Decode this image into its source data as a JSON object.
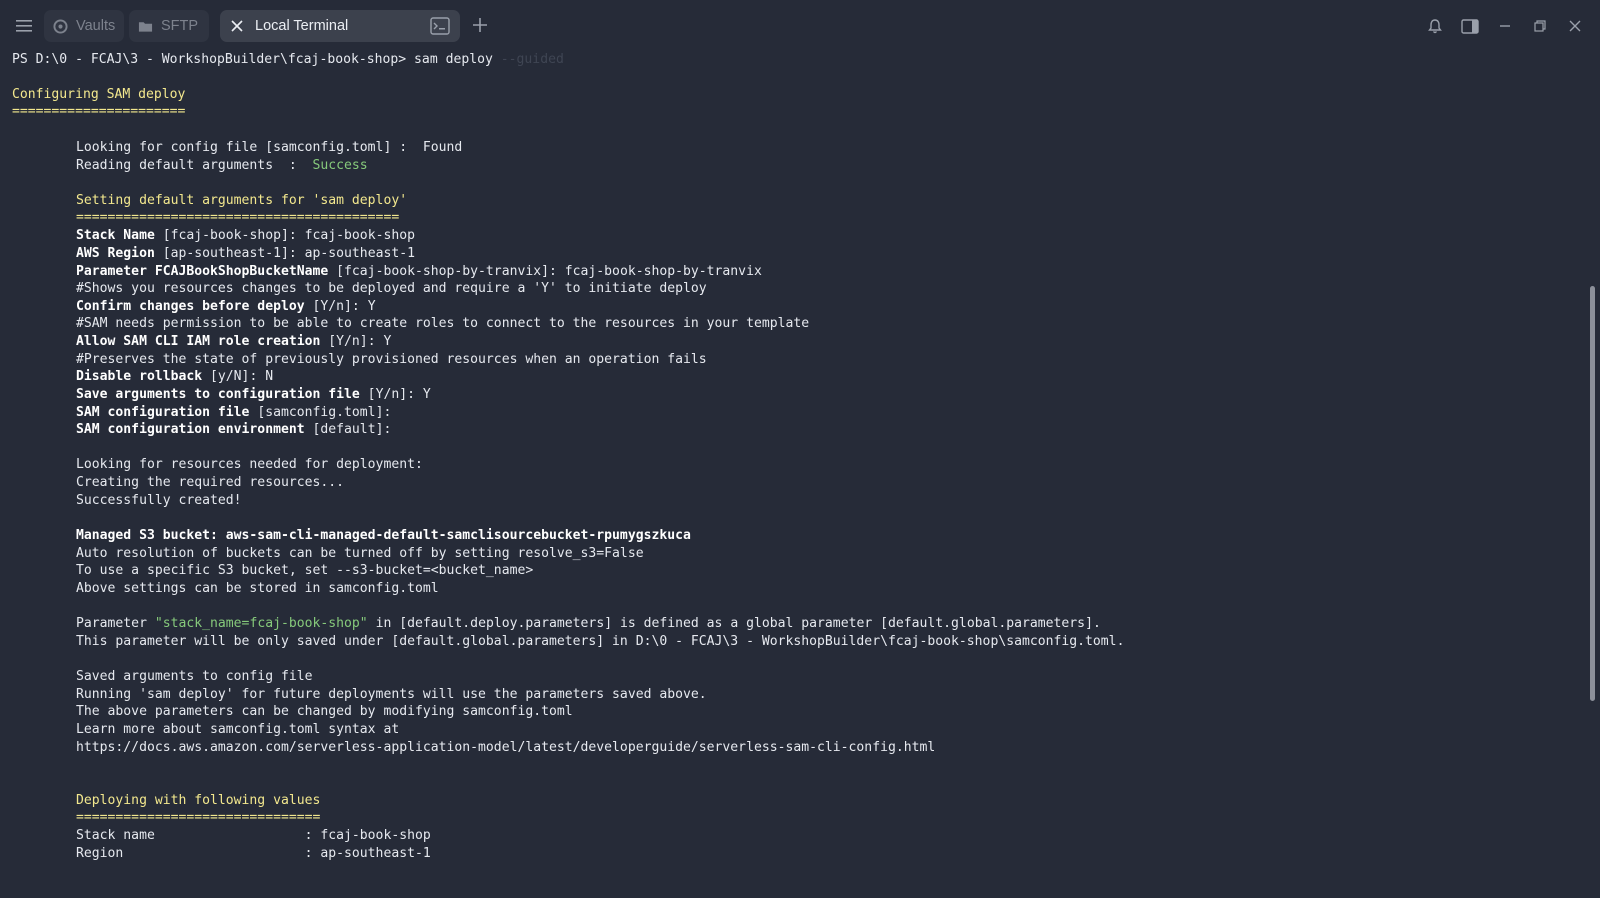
{
  "tabs": [
    {
      "label": "Vaults",
      "icon": "vault-icon"
    },
    {
      "label": "SFTP",
      "icon": "folder-icon"
    },
    {
      "label": "Local Terminal",
      "icon": "close-icon",
      "active": true
    }
  ],
  "window_controls": [
    "new-tab-icon",
    "bell-icon",
    "side-panel-icon",
    "minimize-icon",
    "restore-icon",
    "close-icon"
  ],
  "terminal": {
    "prompt": "PS D:\\0 - FCAJ\\3 - WorkshopBuilder\\fcaj-book-shop> ",
    "command": "sam deploy",
    "suggestion": " --guided",
    "header_title": "Configuring SAM deploy",
    "header_rule": "======================",
    "looking_config": "Looking for config file [samconfig.toml] :  Found",
    "reading_args": "Reading default arguments  :  ",
    "reading_args_status": "Success",
    "setting_title": "Setting default arguments for 'sam deploy'",
    "setting_rule": "=========================================",
    "stack_name_key": "Stack Name",
    "stack_name_val": " [fcaj-book-shop]: fcaj-book-shop",
    "aws_region_key": "AWS Region",
    "aws_region_val": " [ap-southeast-1]: ap-southeast-1",
    "param_bucket_key": "Parameter FCAJBookShopBucketName",
    "param_bucket_val": " [fcaj-book-shop-by-tranvix]: fcaj-book-shop-by-tranvix",
    "comment_changes": "#Shows you resources changes to be deployed and require a 'Y' to initiate deploy",
    "confirm_key": "Confirm changes before deploy",
    "confirm_val": " [Y/n]: Y",
    "comment_roles": "#SAM needs permission to be able to create roles to connect to the resources in your template",
    "iam_key": "Allow SAM CLI IAM role creation",
    "iam_val": " [Y/n]: Y",
    "comment_preserve": "#Preserves the state of previously provisioned resources when an operation fails",
    "rollback_key": "Disable rollback",
    "rollback_val": " [y/N]: N",
    "save_args_key": "Save arguments to configuration file",
    "save_args_val": " [Y/n]: Y",
    "config_file_key": "SAM configuration file",
    "config_file_val": " [samconfig.toml]:",
    "config_env_key": "SAM configuration environment",
    "config_env_val": " [default]:",
    "looking_resources": "Looking for resources needed for deployment:",
    "creating_resources": "Creating the required resources...",
    "success_created": "Successfully created!",
    "managed_bucket": "Managed S3 bucket: aws-sam-cli-managed-default-samclisourcebucket-rpumygszkuca",
    "auto_resolution": "Auto resolution of buckets can be turned off by setting resolve_s3=False",
    "specific_bucket": "To use a specific S3 bucket, set --s3-bucket=<bucket_name>",
    "above_settings": "Above settings can be stored in samconfig.toml",
    "param_prefix": "Parameter ",
    "param_quoted": "\"stack_name=fcaj-book-shop\"",
    "param_suffix": " in [default.deploy.parameters] is defined as a global parameter [default.global.parameters].",
    "param_saved_line": "This parameter will be only saved under [default.global.parameters] in D:\\0 - FCAJ\\3 - WorkshopBuilder\\fcaj-book-shop\\samconfig.toml.",
    "saved_args": "Saved arguments to config file",
    "running_sam": "Running 'sam deploy' for future deployments will use the parameters saved above.",
    "above_params": "The above parameters can be changed by modifying samconfig.toml",
    "learn_more": "Learn more about samconfig.toml syntax at",
    "docs_url": "https://docs.aws.amazon.com/serverless-application-model/latest/developerguide/serverless-sam-cli-config.html",
    "deploying_title": "Deploying with following values",
    "deploying_rule": "===============================",
    "deploy_stack_name": "Stack name                   : fcaj-book-shop",
    "deploy_region": "Region                       : ap-southeast-1"
  },
  "colors": {
    "background": "#262b38",
    "heading_yellow": "#f3e88e",
    "success_green": "#86c97b",
    "text": "#e6e9ef"
  }
}
